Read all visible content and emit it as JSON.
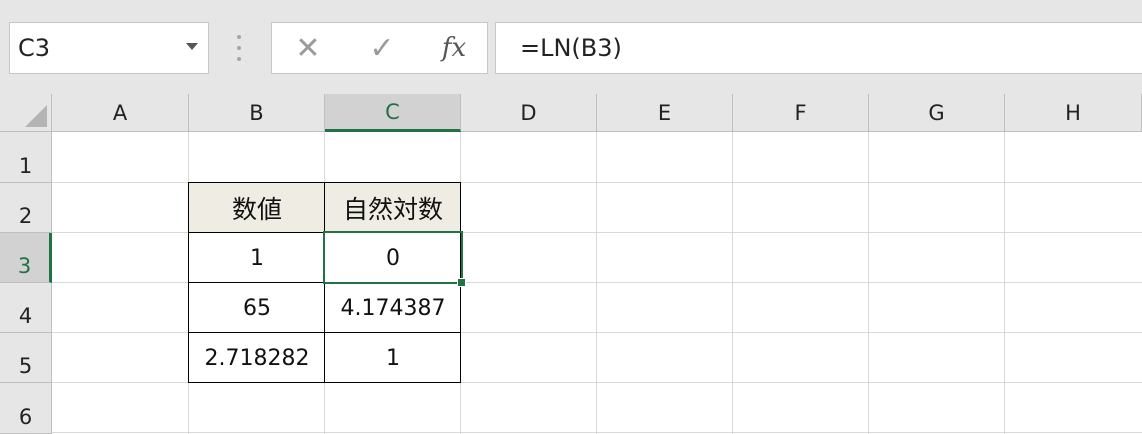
{
  "name_box": {
    "value": "C3"
  },
  "formula_bar": {
    "cancel_glyph": "✕",
    "enter_glyph": "✓",
    "fx_label": "fx",
    "formula": "=LN(B3)"
  },
  "columns": [
    "A",
    "B",
    "C",
    "D",
    "E",
    "F",
    "G",
    "H"
  ],
  "rows": [
    "1",
    "2",
    "3",
    "4",
    "5",
    "6"
  ],
  "table": {
    "header": [
      "数値",
      "自然対数"
    ],
    "rows": [
      [
        "1",
        "0"
      ],
      [
        "65",
        "4.174387"
      ],
      [
        "2.718282",
        "1"
      ]
    ]
  },
  "colors": {
    "accent": "#217346",
    "header_fill": "#efece4"
  }
}
